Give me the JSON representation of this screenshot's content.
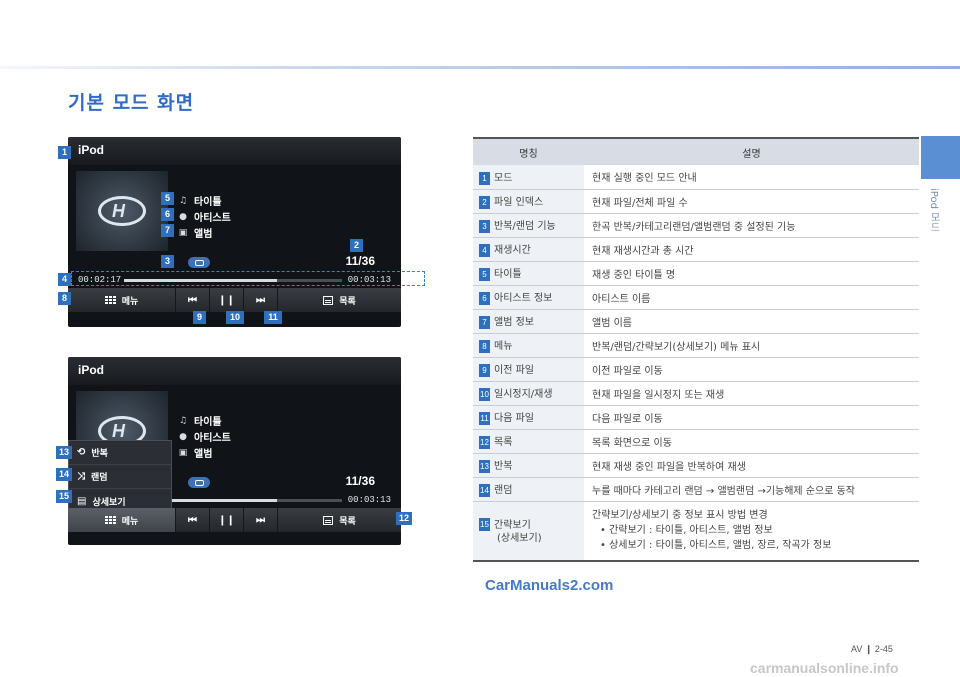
{
  "heading": "기본 모드 화면",
  "side_label": "iPod 모드",
  "screen1": {
    "title": "iPod",
    "track": [
      {
        "icon": "title-icon",
        "label": "타이틀"
      },
      {
        "icon": "artist-icon",
        "label": "아티스트"
      },
      {
        "icon": "album-icon",
        "label": "앨범"
      }
    ],
    "counter": "11/36",
    "elapsed": "00:02:17",
    "total": "00:03:13",
    "progress_fraction": 0.7,
    "menu_label": "메뉴",
    "list_label": "목록",
    "callouts": [
      "1",
      "2",
      "3",
      "4",
      "5",
      "6",
      "7",
      "8",
      "9",
      "10",
      "11"
    ]
  },
  "screen2": {
    "title": "iPod",
    "track": [
      {
        "icon": "title-icon",
        "label": "타이틀"
      },
      {
        "icon": "artist-icon",
        "label": "아티스트"
      },
      {
        "icon": "album-icon",
        "label": "앨범"
      }
    ],
    "counter": "11/36",
    "total": "00:03:13",
    "progress_fraction": 0.7,
    "popup": [
      "반복",
      "랜덤",
      "상세보기"
    ],
    "menu_label": "메뉴",
    "list_label": "목록",
    "callouts": [
      "12",
      "13",
      "14",
      "15"
    ]
  },
  "table": {
    "header_name": "명칭",
    "header_desc": "설명",
    "rows": [
      {
        "num": "1",
        "name": "모드",
        "desc": "현재 실행 중인 모드 안내"
      },
      {
        "num": "2",
        "name": "파일 인덱스",
        "desc": "현재 파일/전체 파일 수"
      },
      {
        "num": "3",
        "name": "반복/랜덤 기능",
        "desc": "한곡 반복/카테고리랜덤/앨범랜덤 중 설정된 기능"
      },
      {
        "num": "4",
        "name": "재생시간",
        "desc": "현재 재생시간과 총 시간"
      },
      {
        "num": "5",
        "name": "타이틀",
        "desc": "재생 중인 타이틀 명"
      },
      {
        "num": "6",
        "name": "아티스트 정보",
        "desc": "아티스트 이름"
      },
      {
        "num": "7",
        "name": "앨범 정보",
        "desc": "앨범 이름"
      },
      {
        "num": "8",
        "name": "메뉴",
        "desc": "반복/랜덤/간략보기(상세보기) 메뉴 표시"
      },
      {
        "num": "9",
        "name": "이전 파일",
        "desc": "이전 파일로 이동"
      },
      {
        "num": "10",
        "name": "일시정지/재생",
        "desc": "현재 파일을 일시정지 또는 재생"
      },
      {
        "num": "11",
        "name": "다음 파일",
        "desc": "다음 파일로 이동"
      },
      {
        "num": "12",
        "name": "목록",
        "desc": "목록 화면으로 이동"
      },
      {
        "num": "13",
        "name": "반복",
        "desc": "현재 재생 중인 파일을 반복하여 재생"
      },
      {
        "num": "14",
        "name": "랜덤",
        "desc": "누를 때마다 카테고리 랜덤 → 앨범랜덤 →기능해제 순으로 동작"
      }
    ],
    "last_row": {
      "num": "15",
      "name": "간략보기",
      "name2": "(상세보기)",
      "desc": "간략보기/상세보기 중 정보 표시 방법 변경",
      "bullets": [
        "간략보기 : 타이틀, 아티스트, 앨범 정보",
        "상세보기 : 타이틀, 아티스트, 앨범, 장르, 작곡가 정보"
      ]
    }
  },
  "watermark": "CarManuals2.com",
  "page_number": "AV  ❙  2-45",
  "footer_watermark": "carmanualsonline.info"
}
